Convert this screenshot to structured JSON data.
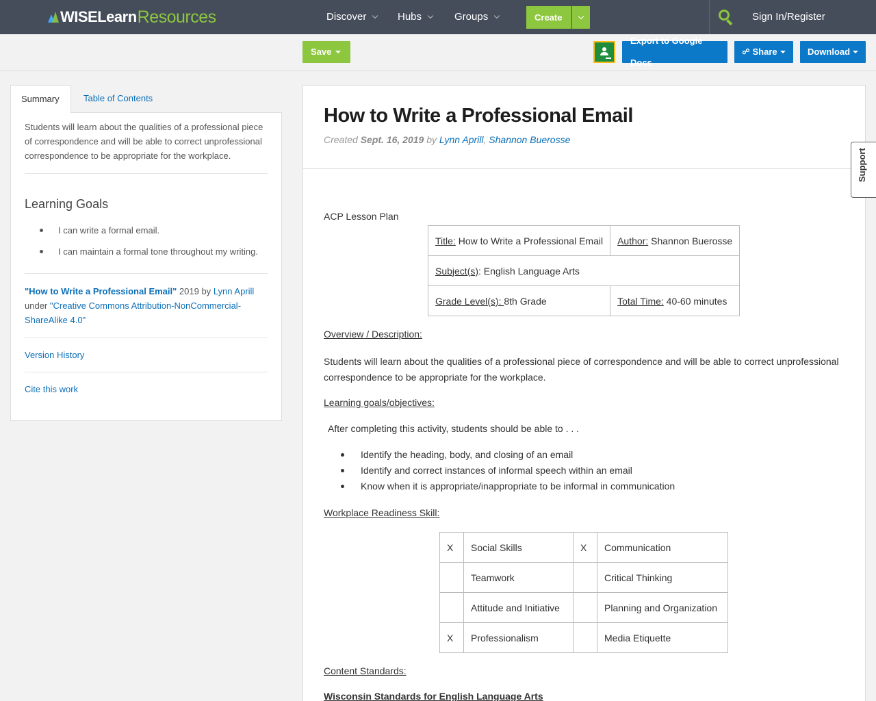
{
  "nav": {
    "logo_wise": "WISELearn",
    "logo_resources": "Resources",
    "items": [
      {
        "label": "Discover"
      },
      {
        "label": "Hubs"
      },
      {
        "label": "Groups"
      }
    ],
    "create_label": "Create",
    "signin_label": "Sign In/Register",
    "search_icon": "search-icon"
  },
  "toolbar": {
    "save_label": "Save",
    "classroom_icon": "google-classroom-icon",
    "export_label": "Export to Google Docs",
    "share_label": "Share",
    "download_label": "Download"
  },
  "sidebar": {
    "tabs": [
      {
        "label": "Summary"
      },
      {
        "label": "Table of Contents"
      }
    ],
    "summary": "Students will learn about the qualities of a professional piece of correspondence and will be able to correct unprofessional correspondence to be appropriate for the workplace.",
    "goals_heading": "Learning Goals",
    "goals": [
      "I can write a formal email.",
      "I can maintain a formal tone throughout my writing."
    ],
    "attribution": {
      "work_title": "\"How to Write a Professional Email\"",
      "year_by": " 2019 by ",
      "author": "Lynn Aprill",
      "under": "under ",
      "license": "\"Creative Commons Attribution-NonCommercial-ShareAlike 4.0\""
    },
    "version_history": "Version History",
    "cite": "Cite this work"
  },
  "main": {
    "title": "How to Write a Professional Email",
    "created_prefix": "Created ",
    "created_date": "Sept. 16, 2019",
    "by": " by ",
    "author1": "Lynn Aprill",
    "sep": ", ",
    "author2": "Shannon Buerosse",
    "plan_label": "ACP Lesson Plan",
    "info_table": {
      "title_label": "Title:",
      "title_value": " How to Write a Professional Email",
      "author_label": "Author:",
      "author_value": " Shannon Buerosse",
      "subject_label": "Subject(s)",
      "subject_value": ":  English Language Arts",
      "grade_label": "Grade Level(s): ",
      "grade_value": "8th Grade",
      "time_label": "Total Time:",
      "time_value": " 40-60 minutes"
    },
    "overview_heading": "Overview / Description:",
    "overview_text": "Students will learn about the qualities of a professional piece of correspondence and will be able to correct unprofessional correspondence to be appropriate for the workplace.",
    "goals_heading": "Learning goals/objectives:",
    "goals_intro": "After completing this activity, students should be able to . . .",
    "objectives": [
      "Identify the heading, body, and closing of an email",
      "Identify and correct instances of informal speech within an email",
      "Know when it is appropriate/inappropriate to be informal in communication"
    ],
    "skill_heading": "Workplace Readiness Skill:",
    "skills": [
      {
        "mark1": "X",
        "skill1": " Social Skills",
        "mark2": "X",
        "skill2": "Communication"
      },
      {
        "mark1": "",
        "skill1": "Teamwork",
        "mark2": "",
        "skill2": "  Critical Thinking"
      },
      {
        "mark1": "",
        "skill1": "Attitude and Initiative",
        "mark2": "",
        "skill2": " Planning and Organization"
      },
      {
        "mark1": "X",
        "skill1": "Professionalism",
        "mark2": "",
        "skill2": " Media Etiquette"
      }
    ],
    "standards_heading": "Content Standards:",
    "standards_sub": "Wisconsin Standards for English Language Arts"
  },
  "support_label": "Support"
}
